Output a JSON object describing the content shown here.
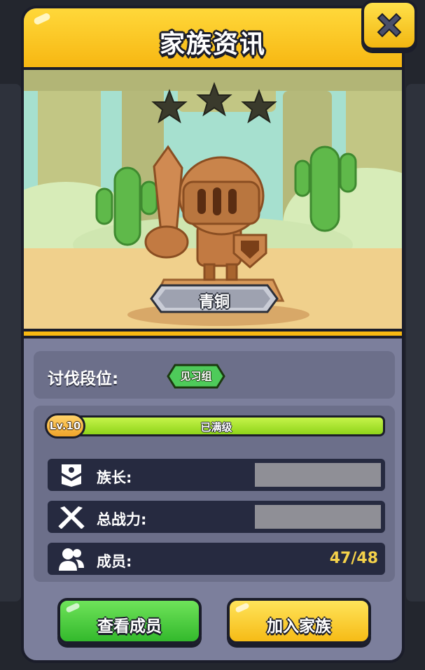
{
  "dialog": {
    "title": "家族资讯"
  },
  "clan": {
    "rank_tier": "青铜",
    "stars_total": 3,
    "stars_filled": 0
  },
  "raid_rank": {
    "label": "讨伐段位:",
    "badge": "见习组"
  },
  "level": {
    "badge": "Lv.10",
    "status": "已满级",
    "progress": 1.0
  },
  "stats": {
    "leader_label": "族长:",
    "leader_value": "",
    "power_label": "总战力:",
    "power_value": "",
    "members_label": "成员:",
    "members_value": "47/48"
  },
  "buttons": {
    "view_members": "查看成员",
    "join_clan": "加入家族"
  },
  "colors": {
    "header_yellow": "#f7b712",
    "panel": "#7c7f9c",
    "bar_green": "#8fd41a",
    "member_count": "#f5d24a",
    "button_green": "#33b92c",
    "button_yellow": "#f6bb16"
  },
  "icons": {
    "close": "close-x-icon",
    "leader": "leader-badge-icon",
    "power": "crossed-swords-icon",
    "members": "members-icon"
  }
}
